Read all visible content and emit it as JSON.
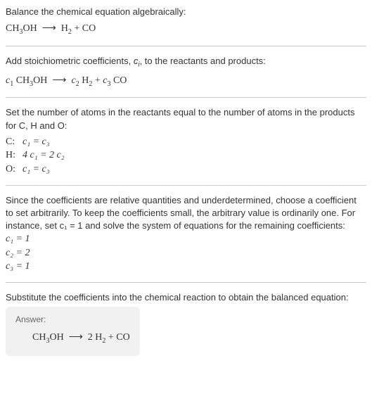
{
  "intro": {
    "title": "Balance the chemical equation algebraically:",
    "equation_lhs": "CH",
    "equation_lhs2": "OH",
    "equation_rhs1": "H",
    "equation_rhs2": "CO"
  },
  "step1": {
    "text": "Add stoichiometric coefficients, ",
    "text2": ", to the reactants and products:",
    "ci": "c",
    "ci_sub": "i"
  },
  "step2": {
    "text": "Set the number of atoms in the reactants equal to the number of atoms in the products for C, H and O:",
    "rows": [
      {
        "label": "C:",
        "eq": "c₁ = c₃"
      },
      {
        "label": "H:",
        "eq": "4 c₁ = 2 c₂"
      },
      {
        "label": "O:",
        "eq": "c₁ = c₃"
      }
    ]
  },
  "step3": {
    "text": "Since the coefficients are relative quantities and underdetermined, choose a coefficient to set arbitrarily. To keep the coefficients small, the arbitrary value is ordinarily one. For instance, set c₁ = 1 and solve the system of equations for the remaining coefficients:",
    "coefs": [
      "c₁ = 1",
      "c₂ = 2",
      "c₃ = 1"
    ]
  },
  "step4": {
    "text": "Substitute the coefficients into the chemical reaction to obtain the balanced equation:"
  },
  "answer": {
    "label": "Answer:",
    "eq_prefix": "CH",
    "eq_mid": "OH",
    "eq_coef2": "2 H",
    "eq_last": "CO"
  },
  "subs": {
    "three": "3",
    "two": "2",
    "one": "1"
  },
  "arrow": "⟶",
  "plus": " + "
}
